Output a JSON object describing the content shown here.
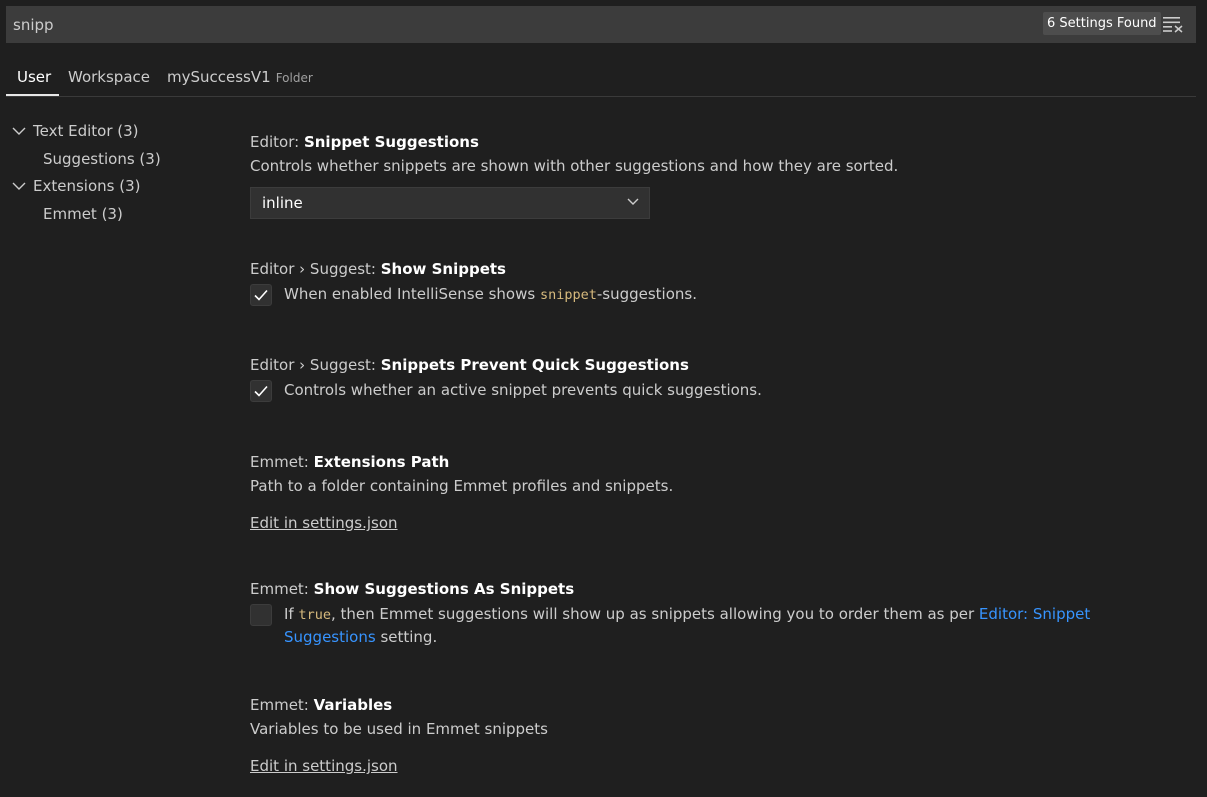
{
  "search": {
    "value": "snipp",
    "count_label": "6 Settings Found",
    "filter_icon": "clear-filter-icon"
  },
  "tabs": [
    {
      "label": "User"
    },
    {
      "label": "Workspace"
    },
    {
      "label": "mySuccessV1",
      "tag": "Folder"
    }
  ],
  "toc": [
    {
      "label": "Text Editor (3)"
    },
    {
      "label": "Suggestions (3)"
    },
    {
      "label": "Extensions (3)"
    },
    {
      "label": "Emmet (3)"
    }
  ],
  "settings": [
    {
      "category": "Editor: ",
      "name": "Snippet Suggestions",
      "description": "Controls whether snippets are shown with other suggestions and how they are sorted.",
      "dropdown_value": "inline"
    },
    {
      "category": "Editor › Suggest: ",
      "name": "Show Snippets",
      "desc_before": "When enabled IntelliSense shows ",
      "desc_code": "snippet",
      "desc_after": "-suggestions.",
      "checked": true
    },
    {
      "category": "Editor › Suggest: ",
      "name": "Snippets Prevent Quick Suggestions",
      "description": "Controls whether an active snippet prevents quick suggestions.",
      "checked": true
    },
    {
      "category": "Emmet: ",
      "name": "Extensions Path",
      "description": "Path to a folder containing Emmet profiles and snippets.",
      "edit_link": "Edit in settings.json"
    },
    {
      "category": "Emmet: ",
      "name": "Show Suggestions As Snippets",
      "desc_before": "If ",
      "desc_code": "true",
      "desc_after": ", then Emmet suggestions will show up as snippets allowing you to order them as per ",
      "desc_link": "Editor: Snippet Suggestions",
      "desc_end": " setting.",
      "checked": false
    },
    {
      "category": "Emmet: ",
      "name": "Variables",
      "description": "Variables to be used in Emmet snippets",
      "edit_link": "Edit in settings.json"
    }
  ],
  "colors": {
    "background": "#1f1f1f",
    "input": "#3c3c3c",
    "link": "#3794ff",
    "code": "#d7ba7d"
  }
}
